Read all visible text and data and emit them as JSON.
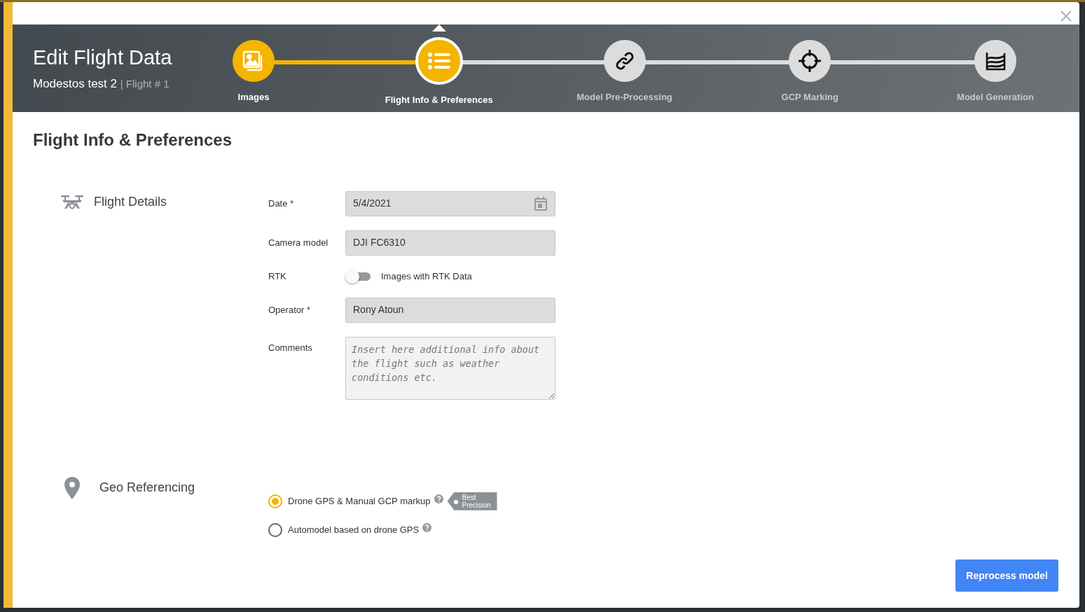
{
  "header": {
    "title": "Edit Flight Data",
    "project": "Modestos test 2",
    "flight": "| Flight # 1"
  },
  "steps": [
    {
      "label": "Images",
      "completed": true,
      "selected": false
    },
    {
      "label": "Flight Info & Preferences",
      "completed": false,
      "selected": true
    },
    {
      "label": "Model Pre-Processing",
      "completed": false,
      "selected": false
    },
    {
      "label": "GCP Marking",
      "completed": false,
      "selected": false
    },
    {
      "label": "Model Generation",
      "completed": false,
      "selected": false
    }
  ],
  "page_title": "Flight Info & Preferences",
  "flight_details": {
    "title": "Flight Details",
    "fields": [
      {
        "kind": "date",
        "label": "Date *",
        "value": "5/4/2021"
      },
      {
        "kind": "text",
        "label": "Camera model",
        "value": "DJI FC6310"
      },
      {
        "kind": "toggle",
        "label": "RTK",
        "text": "Images with RTK Data",
        "on": false
      },
      {
        "kind": "text",
        "label": "Operator *",
        "value": "Rony Atoun"
      },
      {
        "kind": "textarea",
        "label": "Comments",
        "placeholder": "Insert here additional info about the flight such as weather conditions etc."
      }
    ]
  },
  "geo_referencing": {
    "title": "Geo Referencing",
    "options": [
      {
        "label": "Drone GPS & Manual GCP markup",
        "selected": true,
        "tag": "Best Precision"
      },
      {
        "label": "Automodel based on drone GPS",
        "selected": false
      }
    ]
  },
  "button": "Reprocess model"
}
